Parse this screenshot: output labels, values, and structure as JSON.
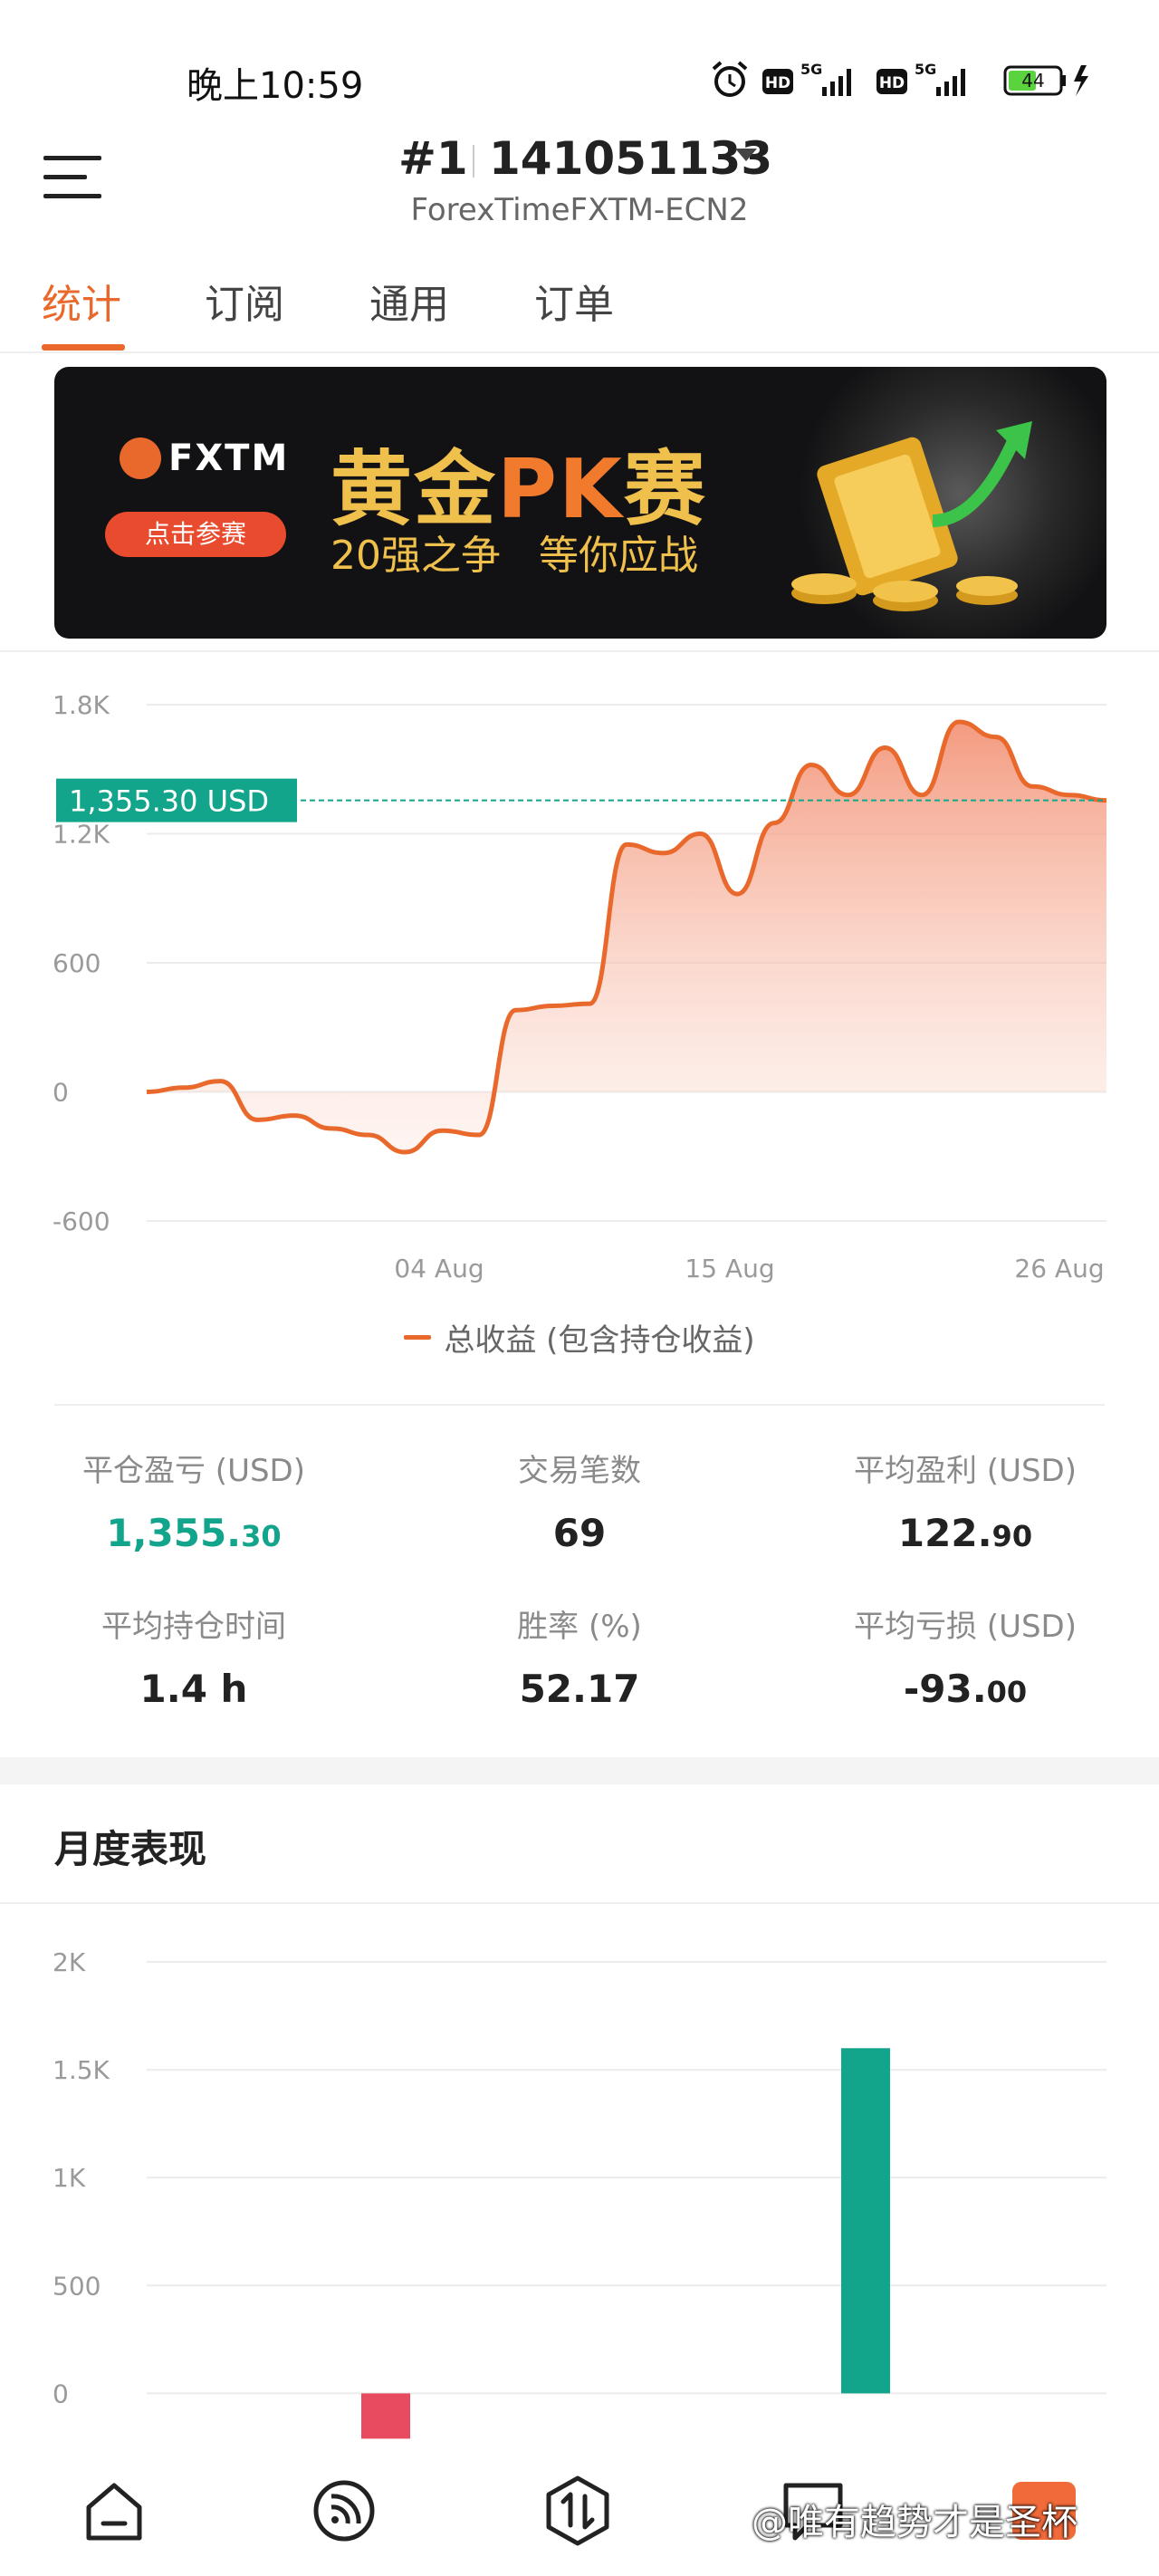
{
  "status_bar": {
    "time": "晚上10:59",
    "battery": "44",
    "network1": "5G",
    "network2": "5G",
    "hd": "HD"
  },
  "header": {
    "account_prefix": "#1",
    "account_number": "141051133",
    "server": "ForexTimeFXTM-ECN2"
  },
  "tabs": [
    {
      "label": "统计",
      "active": true
    },
    {
      "label": "订阅",
      "active": false
    },
    {
      "label": "通用",
      "active": false
    },
    {
      "label": "订单",
      "active": false
    }
  ],
  "banner": {
    "brand": "FXTM",
    "cta": "点击参赛",
    "title_part1": "黄金",
    "title_part2": "PK",
    "title_part3": "赛",
    "subtitle": "20强之争   等你应战"
  },
  "equity_chart": {
    "chart_data": {
      "type": "area",
      "current_value_label": "1,355.30 USD",
      "current_value": 1355.3,
      "y_ticks": [
        "1.8K",
        "1.2K",
        "600",
        "0",
        "-600"
      ],
      "y_tick_values": [
        1800,
        1200,
        600,
        0,
        -600
      ],
      "ylim": [
        -600,
        1800
      ],
      "x_ticks": [
        "04 Aug",
        "15 Aug",
        "26 Aug"
      ],
      "legend": "总收益 (包含持仓收益)",
      "series": [
        {
          "name": "总收益 (包含持仓收益)",
          "color": "#e9692c",
          "values": [
            0,
            20,
            50,
            -130,
            -110,
            -170,
            -200,
            -280,
            -180,
            -200,
            380,
            400,
            410,
            1150,
            1110,
            1200,
            920,
            1250,
            1520,
            1380,
            1600,
            1380,
            1720,
            1650,
            1420,
            1380,
            1355.3
          ]
        }
      ]
    }
  },
  "stats": [
    {
      "label": "平仓盈亏 (USD)",
      "value_main": "1,355.",
      "value_dec": "30",
      "color": "#13a58c"
    },
    {
      "label": "交易笔数",
      "value_main": "69",
      "value_dec": "",
      "color": "#222222"
    },
    {
      "label": "平均盈利 (USD)",
      "value_main": "122.",
      "value_dec": "90",
      "color": "#222222"
    },
    {
      "label": "平均持仓时间",
      "value_main": "1.4 h",
      "value_dec": "",
      "color": "#222222"
    },
    {
      "label": "胜率 (%)",
      "value_main": "52.17",
      "value_dec": "",
      "color": "#222222"
    },
    {
      "label": "平均亏损 (USD)",
      "value_main": "-93.",
      "value_dec": "00",
      "color": "#222222"
    }
  ],
  "monthly": {
    "title": "月度表现",
    "chart_data": {
      "type": "bar",
      "y_ticks": [
        "2K",
        "1.5K",
        "1K",
        "500",
        "0"
      ],
      "y_tick_values": [
        2000,
        1500,
        1000,
        500,
        0
      ],
      "ylim": [
        -200,
        2000
      ],
      "values": [
        -210,
        1600
      ],
      "colors": [
        "#e84a5f",
        "#13a58c"
      ]
    }
  },
  "bottom_nav": {
    "watermark": "@唯有趋势才是圣杯",
    "items": [
      "home-icon",
      "feed-icon",
      "trade-icon",
      "chat-icon",
      "profile-icon"
    ]
  }
}
